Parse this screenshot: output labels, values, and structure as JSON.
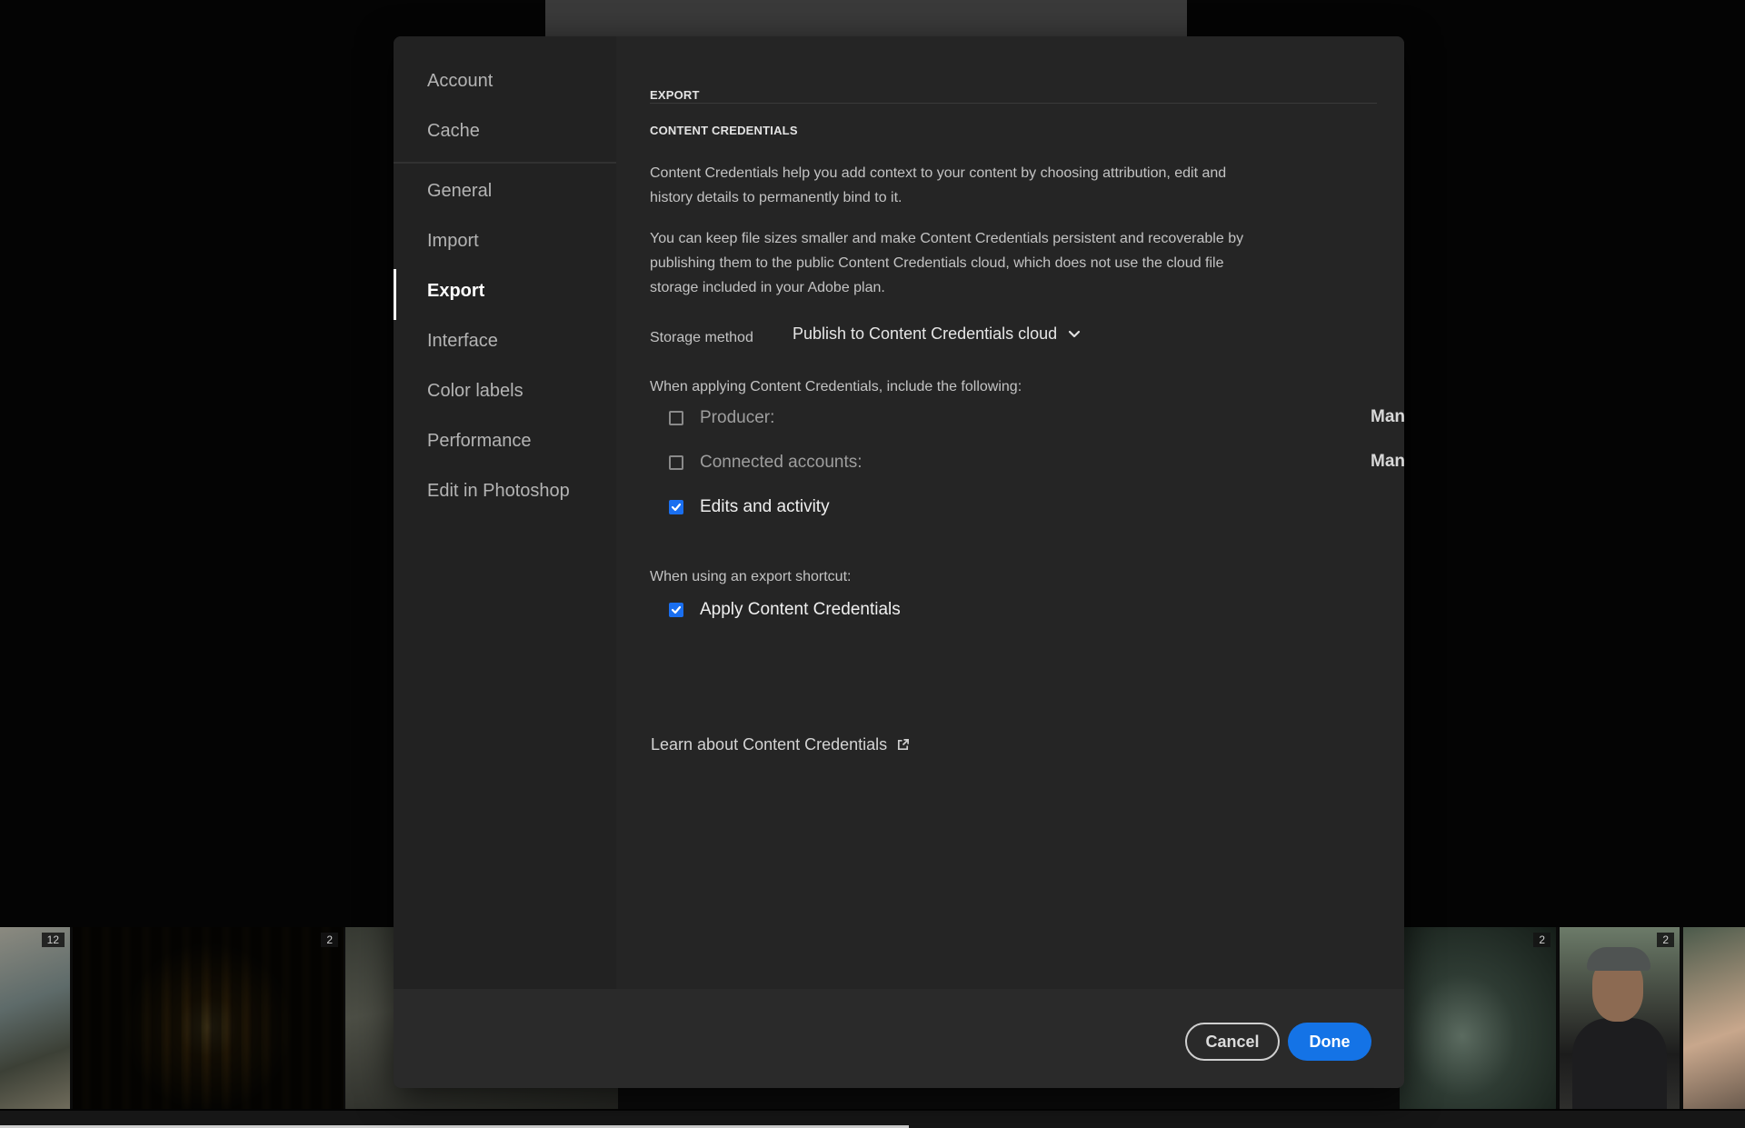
{
  "sidebar": {
    "items": [
      {
        "label": "Account"
      },
      {
        "label": "Cache"
      },
      {
        "label": "General"
      },
      {
        "label": "Import"
      },
      {
        "label": "Export"
      },
      {
        "label": "Interface"
      },
      {
        "label": "Color labels"
      },
      {
        "label": "Performance"
      },
      {
        "label": "Edit in Photoshop"
      }
    ],
    "active": "Export"
  },
  "content": {
    "section_title": "EXPORT",
    "subsection_title": "CONTENT CREDENTIALS",
    "paragraph1": "Content Credentials help you add context to your content by choosing attribution, edit and history details to permanently bind to it.",
    "paragraph2": "You can keep file sizes smaller and make Content Credentials persistent and recoverable by publishing them to the public Content Credentials cloud, which does not use the cloud file storage included in your Adobe plan.",
    "storage_label": "Storage method",
    "storage_value": "Publish to Content Credentials cloud",
    "include_label": "When applying Content Credentials, include the following:",
    "options": [
      {
        "label": "Producer:",
        "checked": false,
        "manage": "Manage"
      },
      {
        "label": "Connected accounts:",
        "checked": false,
        "manage": "Manage"
      },
      {
        "label": "Edits and activity",
        "checked": true
      }
    ],
    "shortcut_label": "When using an export shortcut:",
    "shortcut_option": {
      "label": "Apply Content Credentials",
      "checked": true
    },
    "learn_link": "Learn about Content Credentials"
  },
  "footer": {
    "cancel_label": "Cancel",
    "done_label": "Done"
  },
  "filmstrip": {
    "badges": [
      "12",
      "2",
      "2",
      "2"
    ]
  },
  "colors": {
    "accent": "#1473e6",
    "dialog_bg": "#252525",
    "sidebar_bg": "#222222"
  }
}
